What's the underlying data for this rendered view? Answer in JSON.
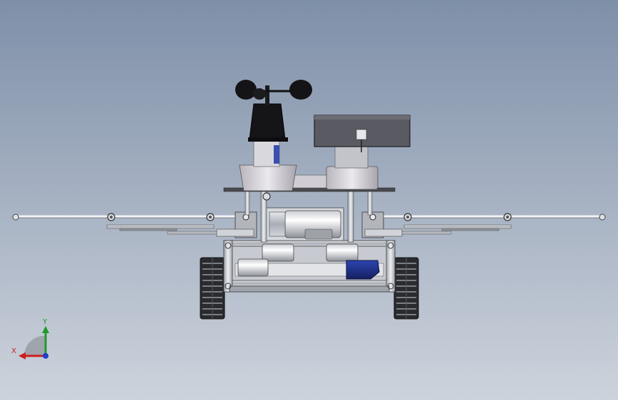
{
  "viewport": {
    "background_top": "#7e8fa8",
    "background_bottom": "#cdd3dc"
  },
  "triad": {
    "x_label": "X",
    "y_label": "Y",
    "x_color": "#cc1f1f",
    "y_color": "#1f9a2a",
    "z_color": "#1f3fcc"
  },
  "model": {
    "parts": [
      "anemometer",
      "solar-panel",
      "sensor-housing",
      "upper-deck",
      "linear-actuator",
      "side-arm-left",
      "side-arm-right",
      "chassis-frame",
      "battery-pack",
      "track-left",
      "track-right"
    ],
    "accent_colors": {
      "battery": "#1d2f8a",
      "anemometer": "#111111",
      "panel": "#55565e"
    }
  }
}
